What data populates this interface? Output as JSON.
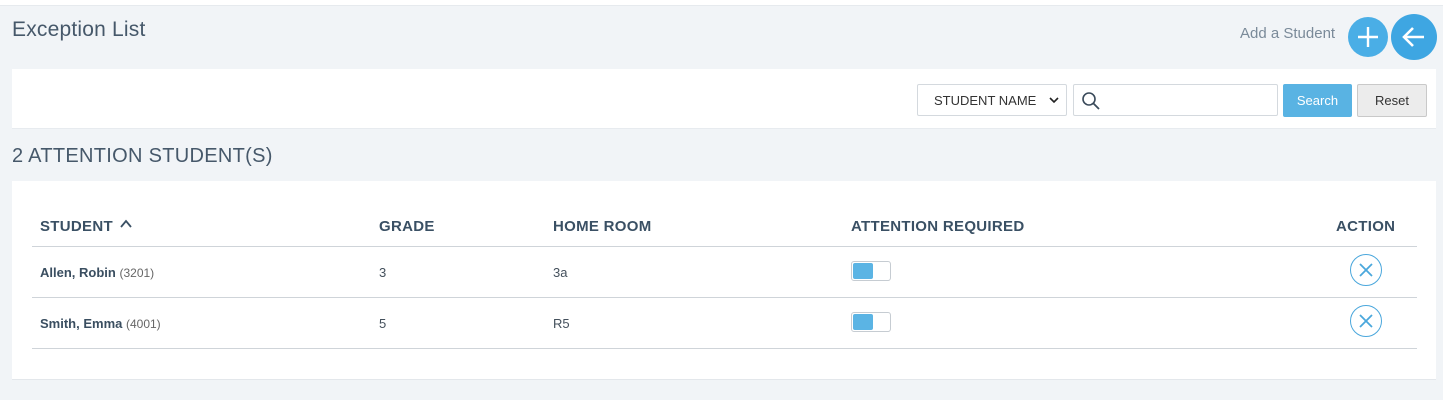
{
  "header": {
    "title": "Exception List",
    "add_label": "Add a Student",
    "add_icon": "plus-icon",
    "back_icon": "arrow-left-icon"
  },
  "search": {
    "filter_value": "STUDENT NAME",
    "input_value": "",
    "input_placeholder": "",
    "search_label": "Search",
    "reset_label": "Reset"
  },
  "summary": {
    "heading": "2 ATTENTION STUDENT(S)"
  },
  "table": {
    "columns": [
      "STUDENT",
      "GRADE",
      "HOME ROOM",
      "ATTENTION REQUIRED",
      "ACTION"
    ],
    "sort_indicator": "chevron-up-icon",
    "rows": [
      {
        "name": "Allen, Robin",
        "id": "(3201)",
        "grade": "3",
        "home_room": "3a",
        "attention_required": true
      },
      {
        "name": "Smith, Emma",
        "id": "(4001)",
        "grade": "5",
        "home_room": "R5",
        "attention_required": true
      }
    ]
  },
  "colors": {
    "accent": "#4aaee6",
    "page_bg": "#f1f4f7",
    "header_text": "#3a5064"
  }
}
